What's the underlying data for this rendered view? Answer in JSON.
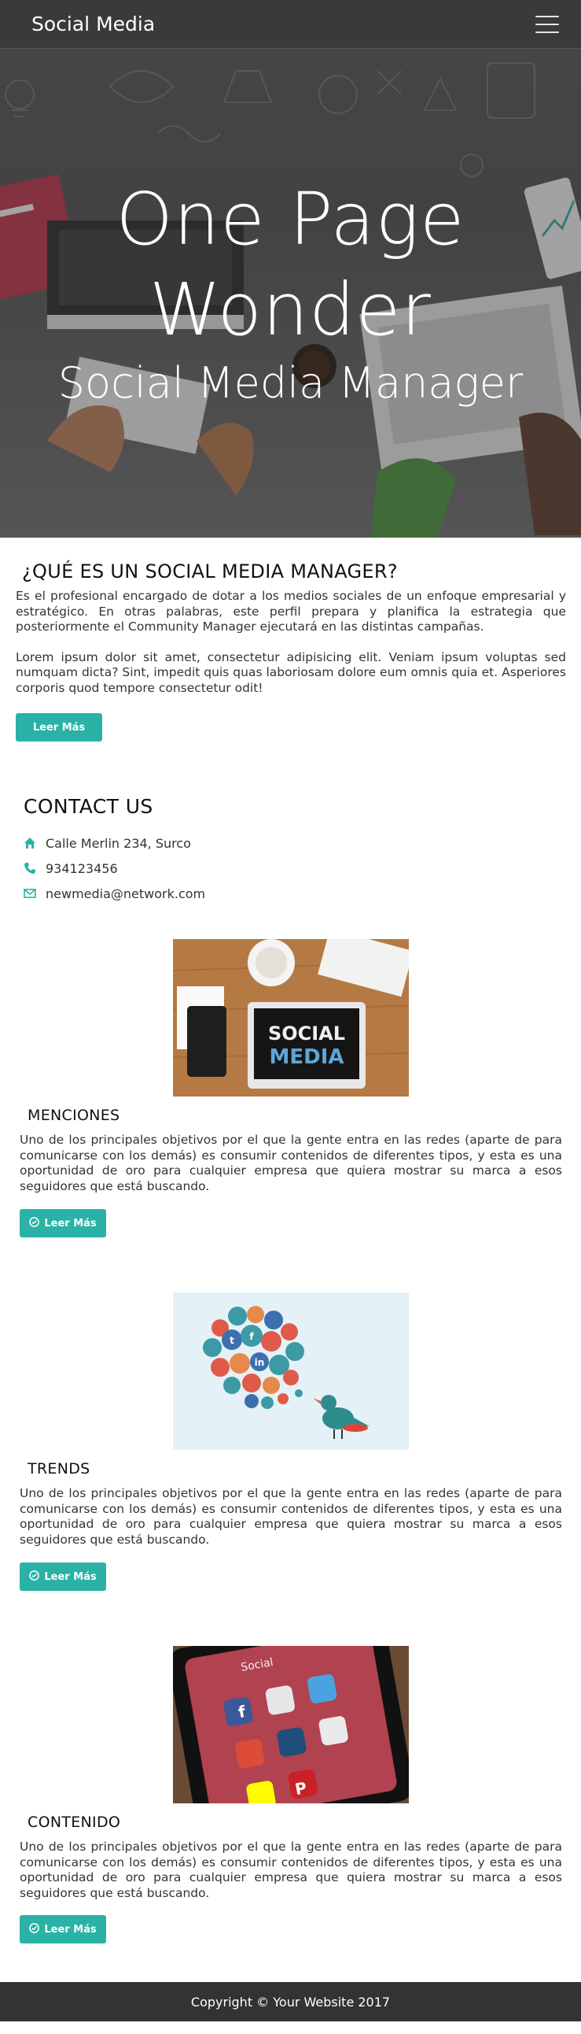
{
  "navbar": {
    "brand": "Social Media"
  },
  "hero": {
    "title_line1": "One Page",
    "title_line2": "Wonder",
    "subtitle": "Social Media Manager"
  },
  "about": {
    "heading": "¿QUÉ ES UN SOCIAL MEDIA MANAGER?",
    "paragraph1": "Es el profesional encargado de dotar a los medios sociales de un enfoque empresarial y estratégico. En otras palabras, este perfil prepara y planifica la estrategia que posteriormente el Community Manager ejecutará en las distintas campañas.",
    "paragraph2": "Lorem ipsum dolor sit amet, consectetur adipisicing elit. Veniam ipsum voluptas sed numquam dicta? Sint, impedit quis quas laboriosam dolore eum omnis quia et. Asperiores corporis quod tempore consectetur odit!",
    "button_label": "Leer Más"
  },
  "contact": {
    "heading": "CONTACT US",
    "address": "Calle Merlin 234, Surco",
    "phone": "934123456",
    "email": "newmedia@network.com"
  },
  "cards": [
    {
      "image_label": "SOCIAL MEDIA",
      "title": "MENCIONES",
      "text": "Uno de los principales objetivos por el que la gente entra en las redes (aparte de para comunicarse con los demás) es consumir contenidos de diferentes tipos, y esta es una oportunidad de oro para cualquier empresa que quiera mostrar su marca a esos seguidores que está buscando.",
      "button_label": "Leer Más"
    },
    {
      "title": "TRENDS",
      "text": "Uno de los principales objetivos por el que la gente entra en las redes (aparte de para comunicarse con los demás) es consumir contenidos de diferentes tipos, y esta es una oportunidad de oro para cualquier empresa que quiera mostrar su marca a esos seguidores que está buscando.",
      "button_label": "Leer Más"
    },
    {
      "image_label": "Social",
      "title": "CONTENIDO",
      "text": "Uno de los principales objetivos por el que la gente entra en las redes (aparte de para comunicarse con los demás) es consumir contenidos de diferentes tipos, y esta es una oportunidad de oro para cualquier empresa que quiera mostrar su marca a esos seguidores que está buscando.",
      "button_label": "Leer Más"
    }
  ],
  "footer": {
    "copyright": "Copyright © Your Website 2017"
  },
  "colors": {
    "accent": "#2ab2a6",
    "navbar_bg": "#3a3a3a",
    "footer_bg": "#333333"
  }
}
